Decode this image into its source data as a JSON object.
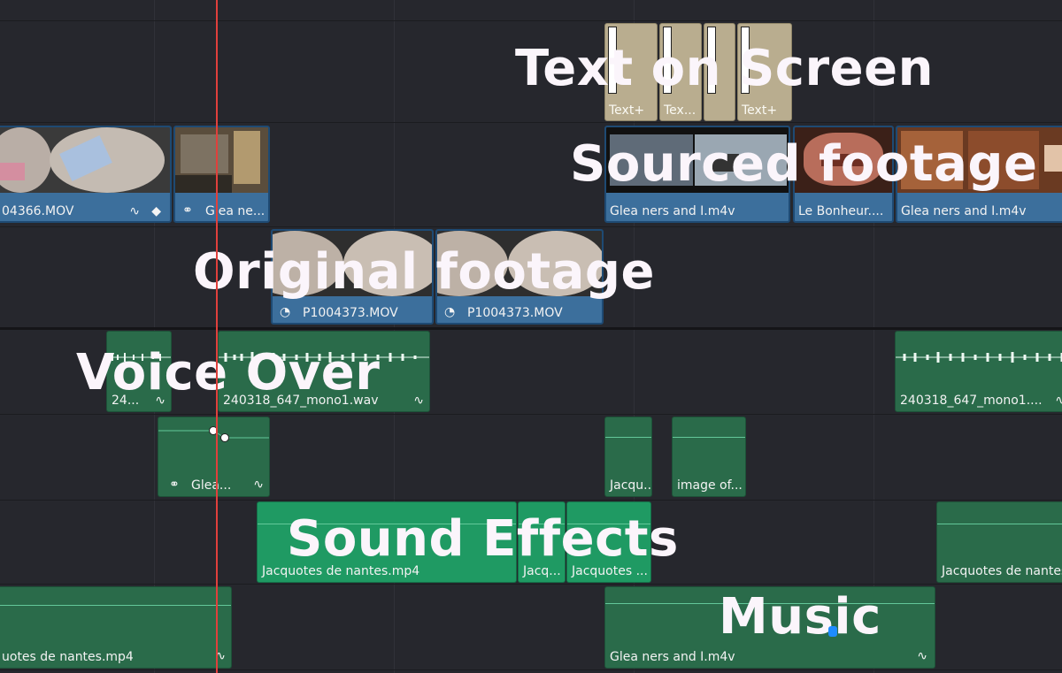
{
  "overlay_labels": {
    "text_on_screen": "Text on Screen",
    "sourced_footage": "Sourced footage",
    "original_footage": "Original footage",
    "voice_over": "Voice Over",
    "sound_effects": "Sound Effects",
    "music": "Music"
  },
  "title_track": {
    "clips": [
      "Text+",
      "Tex...",
      "",
      "Text+"
    ]
  },
  "video_track_2": {
    "clips": [
      "04366.MOV",
      "Glea ne...",
      "Glea ners and I.m4v",
      "Le Bonheur....",
      "Glea ners and I.m4v"
    ]
  },
  "video_track_1": {
    "clips": [
      "P1004373.MOV",
      "P1004373.MOV"
    ]
  },
  "audio_track_1": {
    "clips": [
      "24...",
      "240318_647_mono1.wav",
      "240318_647_mono1...."
    ]
  },
  "audio_track_2": {
    "clips": [
      "Glea...",
      "Jacqu...",
      "image of..."
    ]
  },
  "audio_track_3": {
    "clips": [
      "Jacquotes de nantes.mp4",
      "Jacq...",
      "Jacquotes ...",
      "Jacquotes de nantes"
    ]
  },
  "audio_track_4": {
    "clips": [
      "uotes de nantes.mp4",
      "Glea ners and I.m4v"
    ]
  },
  "icons": [
    "link-icon",
    "speed-icon",
    "curve-icon",
    "keyframe-icon"
  ],
  "colors": {
    "background": "#26272d",
    "video_clip": "#3c6f9c",
    "audio_clip": "#1f9a63",
    "title_clip": "#b9ad8f",
    "playhead": "#e0403c"
  }
}
